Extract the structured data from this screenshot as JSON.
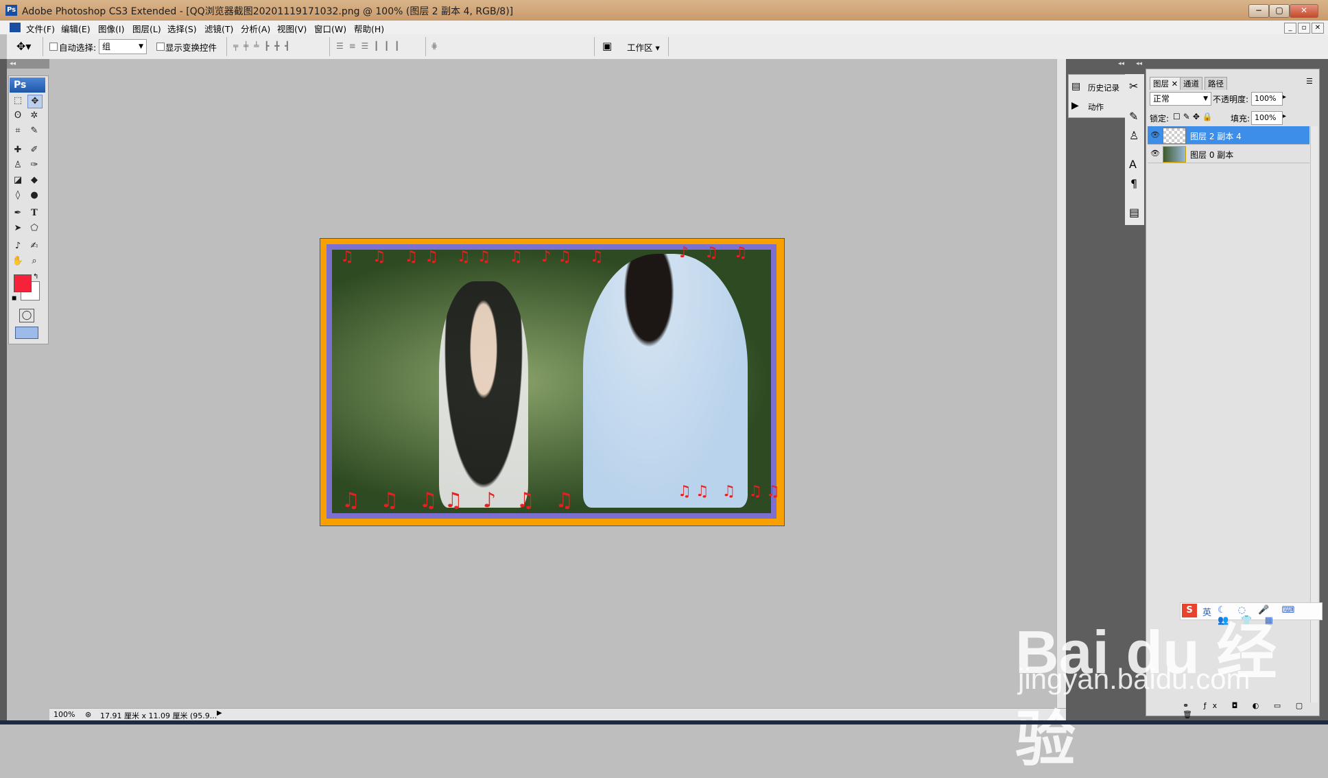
{
  "window": {
    "title": "Adobe Photoshop CS3 Extended - [QQ浏览器截图20201119171032.png @ 100% (图层 2 副本 4, RGB/8)]",
    "app_icon": "Ps",
    "controls": {
      "minimize": "−",
      "maximize": "▢",
      "close": "✕"
    }
  },
  "menubar": {
    "items": [
      "文件(F)",
      "编辑(E)",
      "图像(I)",
      "图层(L)",
      "选择(S)",
      "滤镜(T)",
      "分析(A)",
      "视图(V)",
      "窗口(W)",
      "帮助(H)"
    ],
    "doc_controls": [
      "_",
      "▫",
      "✕"
    ]
  },
  "options": {
    "auto_select_label": "自动选择:",
    "auto_select_value": "组",
    "show_transform_label": "显示变换控件",
    "workspace_label": "工作区"
  },
  "toolbox": {
    "badge": "Ps",
    "foreground_color": "#f5223a",
    "background_color": "#ffffff"
  },
  "side_panel": {
    "history_label": "历史记录",
    "actions_label": "动作"
  },
  "layers_panel": {
    "tabs": [
      "图层",
      "通道",
      "路径"
    ],
    "blend_mode": "正常",
    "opacity_label": "不透明度:",
    "opacity_value": "100%",
    "lock_label": "锁定:",
    "fill_label": "填充:",
    "fill_value": "100%",
    "layers": [
      {
        "name": "图层 2 副本 4",
        "selected": true
      },
      {
        "name": "图层 0 副本",
        "selected": false
      }
    ]
  },
  "statusbar": {
    "zoom": "100%",
    "doc_size": "17.91 厘米 x 11.09 厘米 (95.9..."
  },
  "ime": {
    "lang": "英"
  },
  "watermark": {
    "brand": "Bai du 经验",
    "url": "jingyan.baidu.com"
  }
}
